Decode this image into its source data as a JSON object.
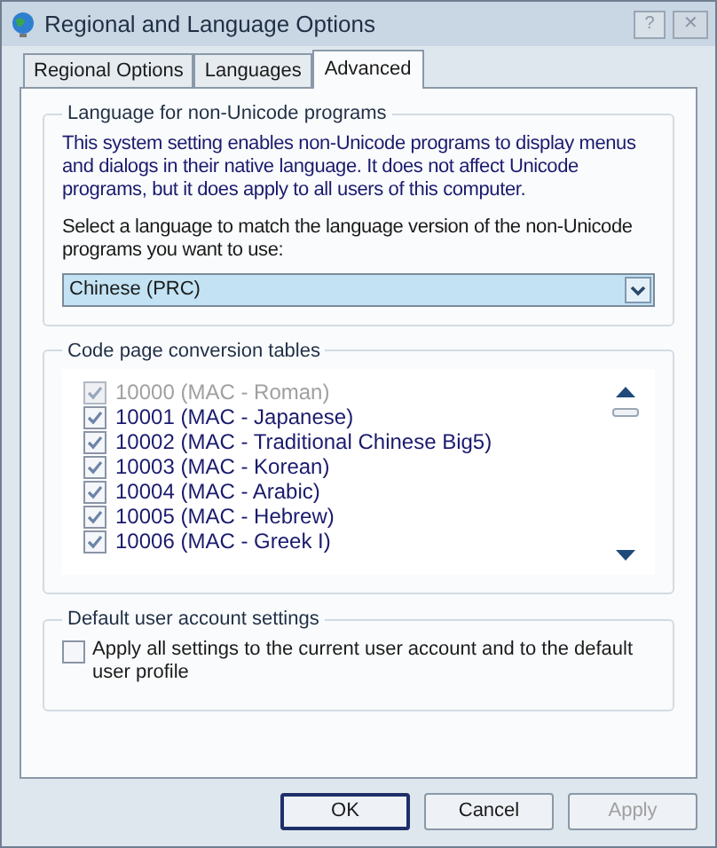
{
  "window": {
    "title": "Regional and Language Options"
  },
  "title_buttons": [
    {
      "kind": "help",
      "label": "?"
    },
    {
      "kind": "close",
      "label": "✕"
    }
  ],
  "tabs": [
    {
      "label": "Regional Options",
      "selected": false
    },
    {
      "label": "Languages",
      "selected": false
    },
    {
      "label": "Advanced",
      "selected": true
    }
  ],
  "non_unicode": {
    "title": "Language for non-Unicode programs",
    "description": "This system setting enables non-Unicode programs to display menus and dialogs in their native language. It does not affect Unicode programs, but it does apply to all users of this computer.",
    "prompt": "Select a language to match the language version of the non-Unicode programs you want to use:",
    "dropdown": {
      "value": "Chinese (PRC)"
    }
  },
  "code_pages": {
    "title": "Code page conversion tables",
    "items": [
      {
        "label": "10000 (MAC - Roman)",
        "checked": true,
        "disabled": true
      },
      {
        "label": "10001 (MAC - Japanese)",
        "checked": true,
        "disabled": false
      },
      {
        "label": "10002 (MAC - Traditional Chinese Big5)",
        "checked": true,
        "disabled": false
      },
      {
        "label": "10003 (MAC - Korean)",
        "checked": true,
        "disabled": false
      },
      {
        "label": "10004 (MAC - Arabic)",
        "checked": true,
        "disabled": false
      },
      {
        "label": "10005 (MAC - Hebrew)",
        "checked": true,
        "disabled": false
      },
      {
        "label": "10006 (MAC - Greek I)",
        "checked": true,
        "disabled": false
      }
    ]
  },
  "default_user": {
    "title": "Default user account settings",
    "checkbox": {
      "label": "Apply all settings to the current user account and to the default user profile",
      "checked": false
    }
  },
  "buttons": [
    {
      "label": "OK",
      "disabled": false,
      "default": true
    },
    {
      "label": "Cancel",
      "disabled": false,
      "default": false
    },
    {
      "label": "Apply",
      "disabled": true,
      "default": false
    }
  ]
}
